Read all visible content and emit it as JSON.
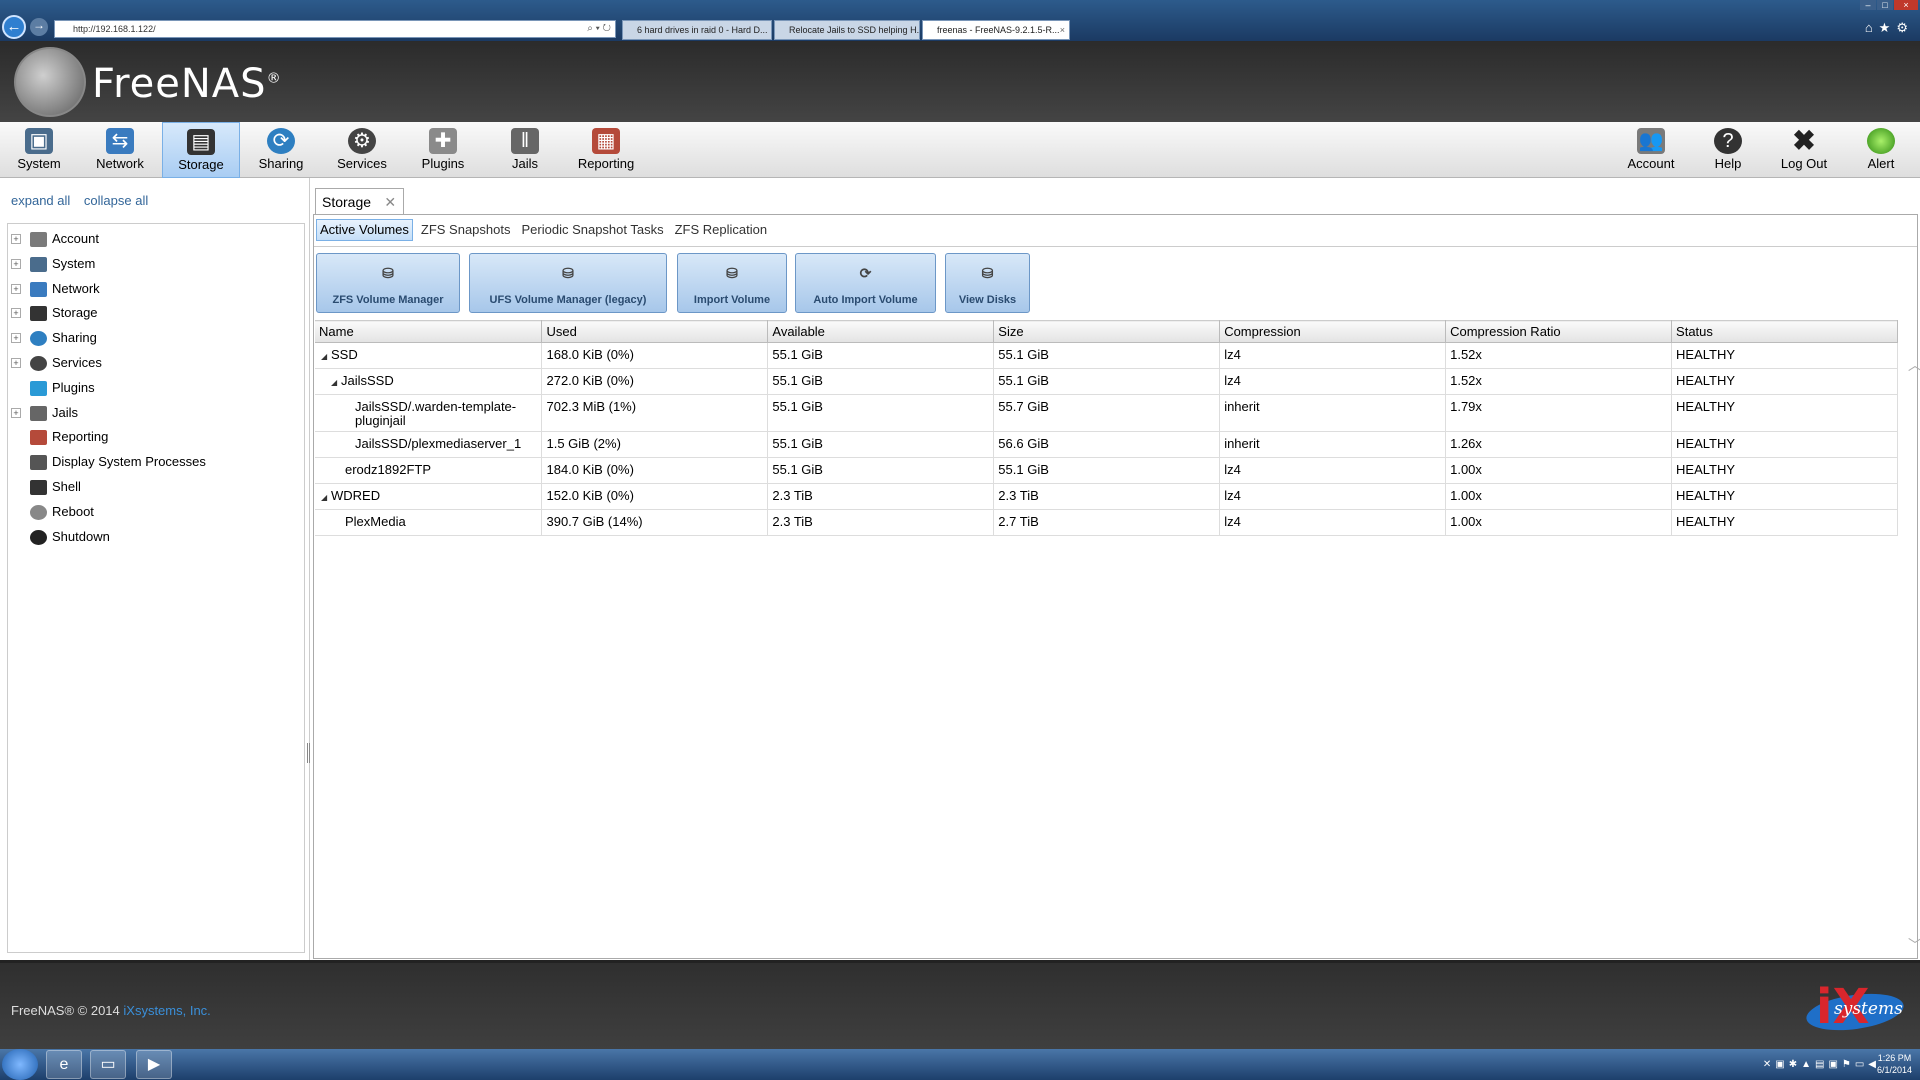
{
  "browser": {
    "url": "http://192.168.1.122/",
    "tabs": [
      {
        "label": "6 hard drives in raid 0 - Hard D...",
        "active": false
      },
      {
        "label": "Relocate Jails to SSD helping H...",
        "active": false
      },
      {
        "label": "freenas - FreeNAS-9.2.1.5-R...",
        "active": true
      }
    ]
  },
  "logo": {
    "text": "FreeNAS",
    "mark": "®"
  },
  "toolbar": {
    "left": [
      "System",
      "Network",
      "Storage",
      "Sharing",
      "Services",
      "Plugins",
      "Jails",
      "Reporting"
    ],
    "right": [
      "Account",
      "Help",
      "Log Out",
      "Alert"
    ],
    "selected": "Storage"
  },
  "tree_controls": {
    "expand": "expand all",
    "collapse": "collapse all"
  },
  "tree": [
    {
      "label": "Account",
      "expandable": true,
      "icon": "account-icon",
      "color": "#7a7a7a"
    },
    {
      "label": "System",
      "expandable": true,
      "icon": "system-icon",
      "color": "#4a6c8c"
    },
    {
      "label": "Network",
      "expandable": true,
      "icon": "network-icon",
      "color": "#3a7bbf"
    },
    {
      "label": "Storage",
      "expandable": true,
      "icon": "storage-icon",
      "color": "#333333"
    },
    {
      "label": "Sharing",
      "expandable": true,
      "icon": "sharing-icon",
      "color": "#2e7fc1"
    },
    {
      "label": "Services",
      "expandable": true,
      "icon": "services-icon",
      "color": "#444444"
    },
    {
      "label": "Plugins",
      "expandable": false,
      "icon": "plugins-icon",
      "color": "#2a9ad6"
    },
    {
      "label": "Jails",
      "expandable": true,
      "icon": "jails-icon",
      "color": "#666666"
    },
    {
      "label": "Reporting",
      "expandable": false,
      "icon": "reporting-icon",
      "color": "#b54a3a"
    },
    {
      "label": "Display System Processes",
      "expandable": false,
      "icon": "processes-icon",
      "color": "#555555"
    },
    {
      "label": "Shell",
      "expandable": false,
      "icon": "shell-icon",
      "color": "#333333"
    },
    {
      "label": "Reboot",
      "expandable": false,
      "icon": "reboot-icon",
      "color": "#888888"
    },
    {
      "label": "Shutdown",
      "expandable": false,
      "icon": "shutdown-icon",
      "color": "#222222"
    }
  ],
  "main": {
    "tab_label": "Storage",
    "subtabs": [
      "Active Volumes",
      "ZFS Snapshots",
      "Periodic Snapshot Tasks",
      "ZFS Replication"
    ],
    "active_subtab": "Active Volumes",
    "actions": [
      "ZFS Volume Manager",
      "UFS Volume Manager (legacy)",
      "Import Volume",
      "Auto Import Volume",
      "View Disks"
    ],
    "columns": [
      "Name",
      "Used",
      "Available",
      "Size",
      "Compression",
      "Compression Ratio",
      "Status"
    ],
    "rows": [
      {
        "name": "SSD",
        "level": 0,
        "toggle": true,
        "used": "168.0 KiB (0%)",
        "available": "55.1 GiB",
        "size": "55.1 GiB",
        "compression": "lz4",
        "ratio": "1.52x",
        "status": "HEALTHY"
      },
      {
        "name": "JailsSSD",
        "level": 1,
        "toggle": true,
        "used": "272.0 KiB (0%)",
        "available": "55.1 GiB",
        "size": "55.1 GiB",
        "compression": "lz4",
        "ratio": "1.52x",
        "status": "HEALTHY"
      },
      {
        "name": "JailsSSD/.warden-template-pluginjail",
        "level": 2,
        "toggle": false,
        "used": "702.3 MiB (1%)",
        "available": "55.1 GiB",
        "size": "55.7 GiB",
        "compression": "inherit",
        "ratio": "1.79x",
        "status": "HEALTHY"
      },
      {
        "name": "JailsSSD/plexmediaserver_1",
        "level": 2,
        "toggle": false,
        "used": "1.5 GiB (2%)",
        "available": "55.1 GiB",
        "size": "56.6 GiB",
        "compression": "inherit",
        "ratio": "1.26x",
        "status": "HEALTHY"
      },
      {
        "name": "erodz1892FTP",
        "level": 1,
        "toggle": false,
        "used": "184.0 KiB (0%)",
        "available": "55.1 GiB",
        "size": "55.1 GiB",
        "compression": "lz4",
        "ratio": "1.00x",
        "status": "HEALTHY"
      },
      {
        "name": "WDRED",
        "level": 0,
        "toggle": true,
        "used": "152.0 KiB (0%)",
        "available": "2.3 TiB",
        "size": "2.3 TiB",
        "compression": "lz4",
        "ratio": "1.00x",
        "status": "HEALTHY"
      },
      {
        "name": "PlexMedia",
        "level": 1,
        "toggle": false,
        "used": "390.7 GiB (14%)",
        "available": "2.3 TiB",
        "size": "2.7 TiB",
        "compression": "lz4",
        "ratio": "1.00x",
        "status": "HEALTHY"
      }
    ]
  },
  "footer": {
    "copyright": "FreeNAS® © 2014",
    "company": "iXsystems, Inc.",
    "logo_text": "systems",
    "logo_mark": "iX"
  },
  "taskbar": {
    "time": "1:26 PM",
    "date": "6/1/2014"
  }
}
